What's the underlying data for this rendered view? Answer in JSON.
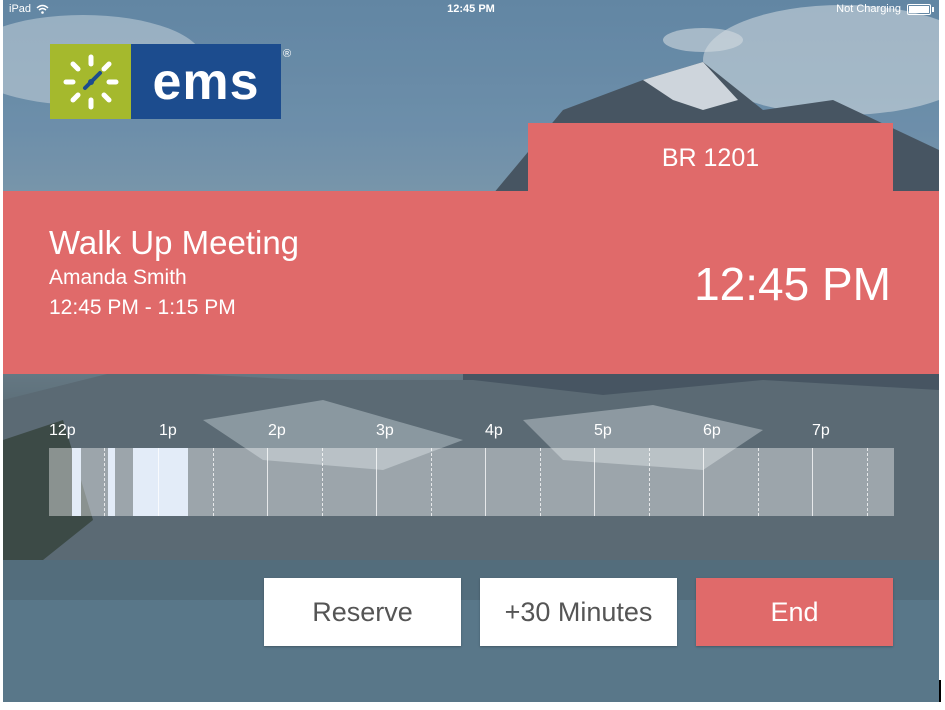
{
  "status_bar": {
    "device": "iPad",
    "time": "12:45 PM",
    "battery_status": "Not Charging"
  },
  "logo": {
    "text": "ems",
    "registered": "®",
    "sun_color": "#a5b92d",
    "box_color": "#1c4c8e"
  },
  "room": {
    "name": "BR 1201"
  },
  "meeting": {
    "title": "Walk Up Meeting",
    "organizer": "Amanda Smith",
    "time_range": "12:45 PM - 1:15 PM",
    "current_time": "12:45 PM"
  },
  "timeline": {
    "hour_labels": [
      "12p",
      "1p",
      "2p",
      "3p",
      "4p",
      "5p",
      "6p",
      "7p"
    ]
  },
  "actions": {
    "reserve": "Reserve",
    "extend": "+30 Minutes",
    "end": "End"
  },
  "colors": {
    "accent": "#e06a6a"
  }
}
